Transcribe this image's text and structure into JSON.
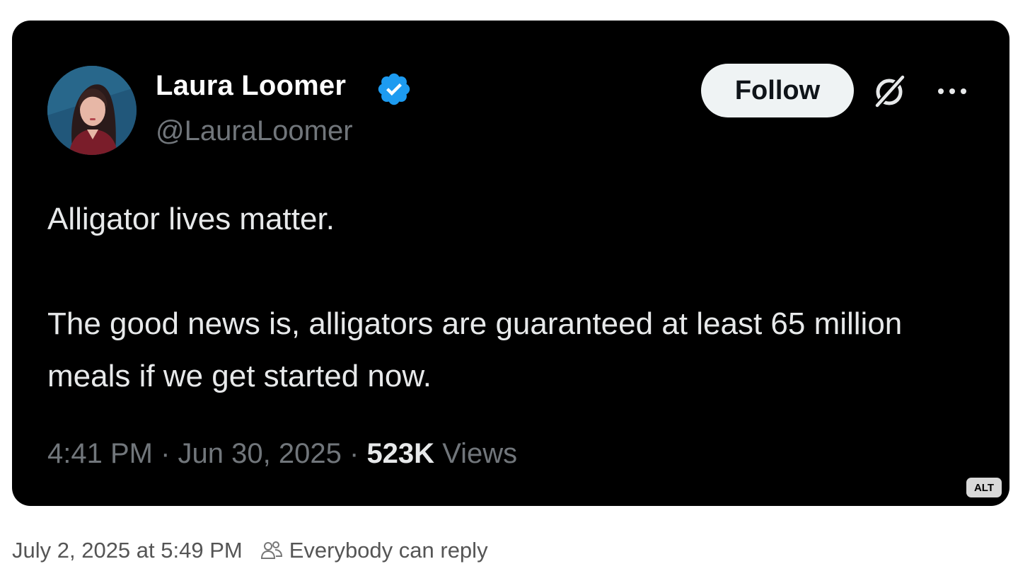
{
  "tweet": {
    "author": {
      "name": "Laura Loomer",
      "handle": "@LauraLoomer",
      "verified": true,
      "verified_color": "#1d9bf0"
    },
    "follow_label": "Follow",
    "icons": {
      "grok": "grok-icon",
      "more": "more-icon",
      "verified": "verified-badge-icon"
    },
    "text_line_1": "Alligator lives matter.",
    "text_line_2": "The good news is, alligators are guaranteed at least 65 million meals if we get started now.",
    "time": "4:41 PM",
    "separator": "·",
    "date": "Jun 30, 2025",
    "views_count": "523K",
    "views_label": "Views",
    "alt_badge": "ALT",
    "background": "#000000"
  },
  "footer": {
    "posted_at": "July 2, 2025 at 5:49 PM",
    "reply_scope": "Everybody can reply",
    "reply_icon": "people-icon"
  }
}
